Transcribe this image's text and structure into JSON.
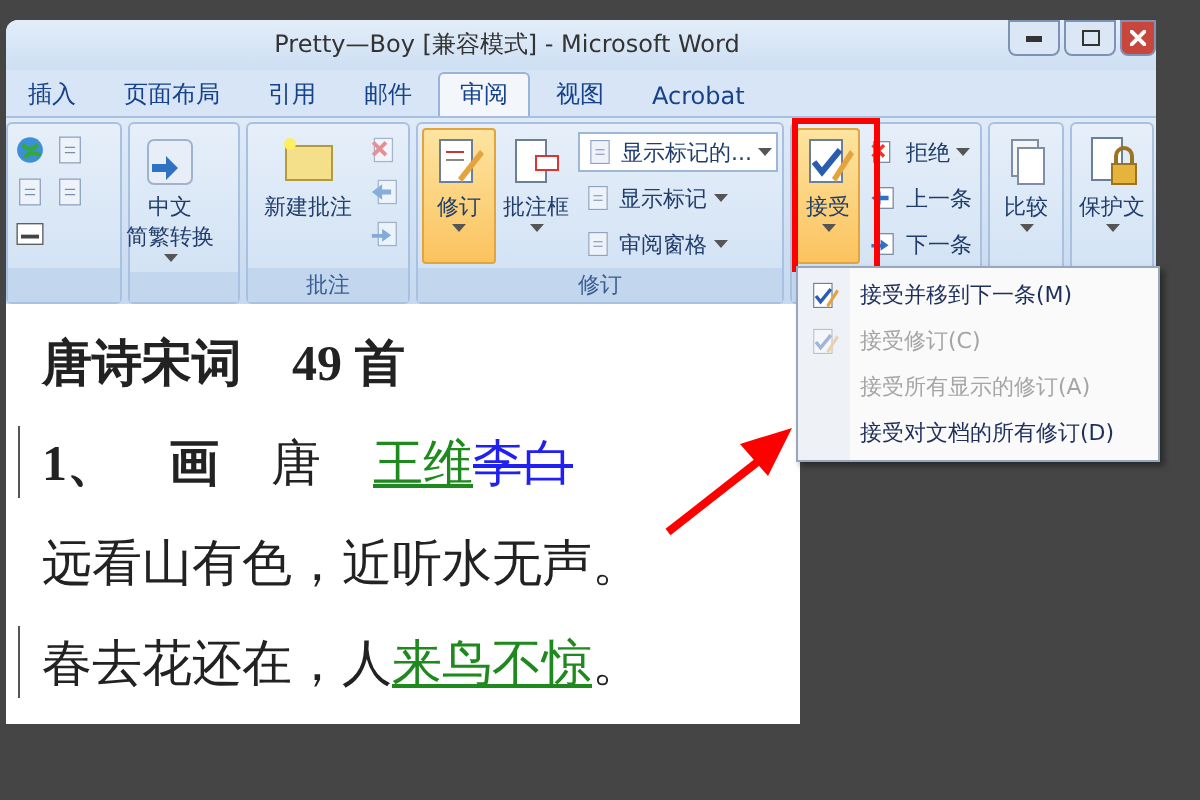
{
  "window": {
    "title": "Pretty—Boy [兼容模式] - Microsoft Word"
  },
  "tabs": [
    {
      "label": "插入",
      "selected": false
    },
    {
      "label": "页面布局",
      "selected": false
    },
    {
      "label": "引用",
      "selected": false
    },
    {
      "label": "邮件",
      "selected": false
    },
    {
      "label": "审阅",
      "selected": true
    },
    {
      "label": "视图",
      "selected": false
    },
    {
      "label": "Acrobat",
      "selected": false
    }
  ],
  "ribbon": {
    "groups": [
      {
        "kind": "icons"
      },
      {
        "kind": "big",
        "buttons": [
          {
            "lines": [
              "中文",
              "简繁转换"
            ],
            "selected": false,
            "dropdown": true
          }
        ]
      },
      {
        "kind": "comments",
        "label": "批注",
        "buttons": [
          {
            "lines": [
              "新建批注"
            ],
            "selected": false,
            "dropdown": false
          }
        ]
      },
      {
        "kind": "tracking",
        "label": "修订",
        "buttons": [
          {
            "lines": [
              "修订"
            ],
            "selected": true,
            "dropdown": true
          },
          {
            "lines": [
              "批注框"
            ],
            "selected": false,
            "dropdown": true
          }
        ],
        "options": [
          {
            "label": "显示标记的...",
            "kind": "select"
          },
          {
            "label": "显示标记",
            "kind": "menu"
          },
          {
            "label": "审阅窗格",
            "kind": "menu"
          }
        ]
      },
      {
        "kind": "changes",
        "buttons": [
          {
            "lines": [
              "接受"
            ],
            "selected": true,
            "dropdown": true
          }
        ],
        "options": [
          {
            "label": "拒绝",
            "kind": "menu"
          },
          {
            "label": "上一条",
            "kind": "plain"
          },
          {
            "label": "下一条",
            "kind": "plain"
          }
        ]
      },
      {
        "kind": "big",
        "buttons": [
          {
            "lines": [
              "比较"
            ],
            "selected": false,
            "dropdown": true
          }
        ]
      },
      {
        "kind": "big",
        "buttons": [
          {
            "lines": [
              "保护文"
            ],
            "selected": false,
            "dropdown": true
          }
        ]
      }
    ]
  },
  "menu": {
    "items": [
      {
        "label": "接受并移到下一条(M)",
        "disabled": false,
        "icon": true
      },
      {
        "label": "接受修订(C)",
        "disabled": true,
        "icon": true
      },
      {
        "label": "接受所有显示的修订(A)",
        "disabled": true,
        "icon": false
      },
      {
        "label": "接受对文档的所有修订(D)",
        "disabled": false,
        "icon": false
      }
    ]
  },
  "document": {
    "paragraphs": [
      {
        "changed": false,
        "segments": [
          {
            "text": "唐诗宋词　49 首",
            "bold": true,
            "inserted": false,
            "deleted": false
          }
        ]
      },
      {
        "changed": true,
        "segments": [
          {
            "text": "1、",
            "bold": true,
            "inserted": false,
            "deleted": false
          },
          {
            "text": "画",
            "bold": true,
            "inserted": false,
            "deleted": false
          },
          {
            "text": "唐",
            "bold": false,
            "inserted": false,
            "deleted": false
          },
          {
            "text": "王维",
            "bold": false,
            "inserted": true,
            "deleted": false
          },
          {
            "text": "李白",
            "bold": false,
            "inserted": false,
            "deleted": true
          }
        ]
      },
      {
        "changed": false,
        "segments": [
          {
            "text": "远看山有色，近听水无声。",
            "bold": false,
            "inserted": false,
            "deleted": false
          }
        ]
      },
      {
        "changed": true,
        "segments": [
          {
            "text": "春去花还在，人",
            "bold": false,
            "inserted": false,
            "deleted": false
          },
          {
            "text": "来鸟不惊",
            "bold": false,
            "inserted": true,
            "deleted": false
          },
          {
            "text": "。",
            "bold": false,
            "inserted": false,
            "deleted": false
          }
        ]
      }
    ]
  }
}
